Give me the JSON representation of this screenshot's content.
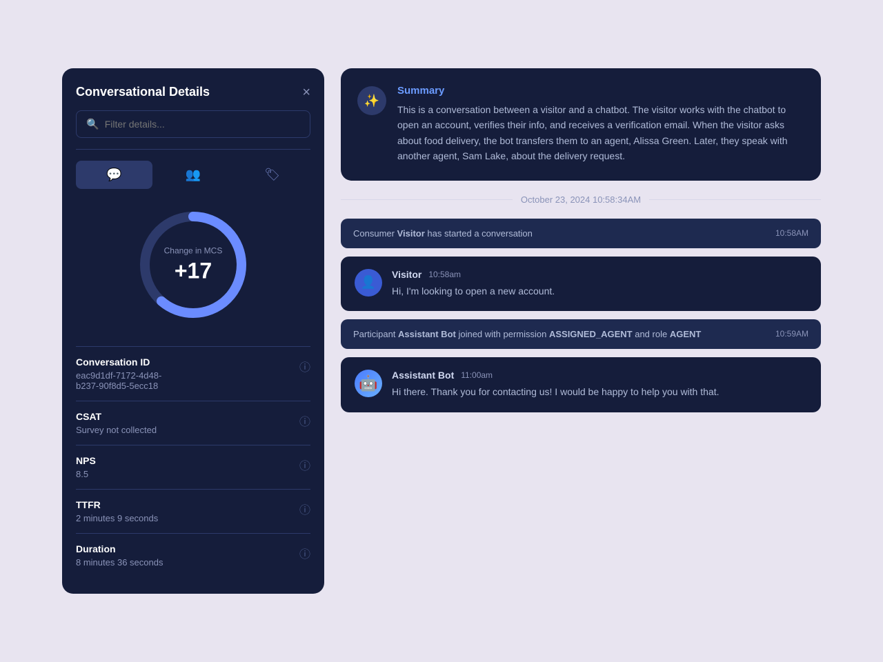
{
  "leftPanel": {
    "title": "Conversational Details",
    "close_label": "×",
    "search": {
      "placeholder": "Filter details..."
    },
    "tabs": [
      {
        "id": "chat",
        "icon": "💬",
        "label": "chat-tab",
        "active": true
      },
      {
        "id": "people",
        "icon": "👥",
        "label": "people-tab",
        "active": false
      },
      {
        "id": "tag",
        "icon": "🏷",
        "label": "tag-tab",
        "active": false
      }
    ],
    "gauge": {
      "label": "Change in MCS",
      "value": "+17"
    },
    "details": [
      {
        "id": "conversation-id",
        "label": "Conversation ID",
        "value": "eac9d1df-7172-4d48-b237-90f8d5-5ecc18"
      },
      {
        "id": "csat",
        "label": "CSAT",
        "value": "Survey not collected"
      },
      {
        "id": "nps",
        "label": "NPS",
        "value": "8.5"
      },
      {
        "id": "ttfr",
        "label": "TTFR",
        "value": "2 minutes 9 seconds"
      },
      {
        "id": "duration",
        "label": "Duration",
        "value": "8 minutes 36 seconds"
      }
    ]
  },
  "rightPanel": {
    "summary": {
      "icon": "✨",
      "title": "Summary",
      "text": "This is a conversation between a visitor and a chatbot. The visitor works with the chatbot to open an account, verifies their info, and receives a verification email. When the visitor asks about food delivery, the bot transfers them to an agent, Alissa Green. Later, they speak with another agent, Sam Lake, about the delivery request."
    },
    "dateDivider": "October 23, 2024 10:58:34AM",
    "messages": [
      {
        "type": "system",
        "text_pre": "Consumer ",
        "bold": "Visitor",
        "text_post": " has started a conversation",
        "time": "10:58AM"
      },
      {
        "type": "chat",
        "avatar_type": "visitor",
        "sender": "Visitor",
        "time": "10:58am",
        "text": "Hi, I'm looking to open a new account."
      },
      {
        "type": "system-multiline",
        "text_pre": "Participant ",
        "bold1": "Assistant Bot",
        "text_mid": " joined with permission ",
        "bold2": "ASSIGNED_AGENT",
        "text_end": " and role ",
        "bold3": "AGENT",
        "time": "10:59AM"
      },
      {
        "type": "chat",
        "avatar_type": "bot",
        "sender": "Assistant Bot",
        "time": "11:00am",
        "text": "Hi there. Thank you for contacting us! I would be happy to help you with that."
      }
    ]
  }
}
